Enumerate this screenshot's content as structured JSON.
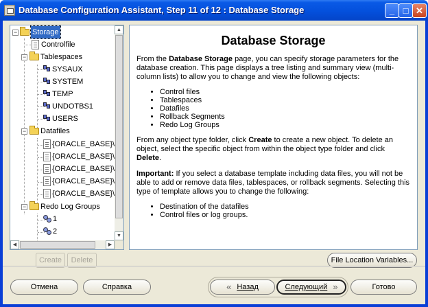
{
  "window": {
    "title": "Database Configuration Assistant, Step 11 of 12 : Database Storage",
    "controls": {
      "minimize": "_",
      "maximize": "□",
      "close": "✕"
    }
  },
  "tree": {
    "root": "Storage",
    "items": [
      {
        "label": "Controlfile"
      },
      {
        "label": "Tablespaces"
      },
      {
        "label": "SYSAUX"
      },
      {
        "label": "SYSTEM"
      },
      {
        "label": "TEMP"
      },
      {
        "label": "UNDOTBS1"
      },
      {
        "label": "USERS"
      },
      {
        "label": "Datafiles"
      },
      {
        "label": "{ORACLE_BASE}\\or"
      },
      {
        "label": "{ORACLE_BASE}\\or"
      },
      {
        "label": "{ORACLE_BASE}\\or"
      },
      {
        "label": "{ORACLE_BASE}\\or"
      },
      {
        "label": "{ORACLE_BASE}\\or"
      },
      {
        "label": "Redo Log Groups"
      },
      {
        "label": "1"
      },
      {
        "label": "2"
      }
    ],
    "icons": {
      "folder": "folder-icon",
      "file": "file-icon",
      "tablespace": "tablespace-icon",
      "log": "log-group-icon"
    }
  },
  "content": {
    "heading": "Database Storage",
    "p1_pre": "From the ",
    "p1_bold": "Database Storage",
    "p1_post": " page, you can specify storage parameters for the database creation. This page displays a tree listing and summary view (multi-column lists) to allow you to change and view the following objects:",
    "list1": [
      "Control files",
      "Tablespaces",
      "Datafiles",
      "Rollback Segments",
      "Redo Log Groups"
    ],
    "p2_a": "From any object type folder, click ",
    "p2_b": "Create",
    "p2_c": " to create a new object. To delete an object, select the specific object from within the object type folder and click ",
    "p2_d": "Delete",
    "p2_e": ".",
    "p3_bold": "Important:",
    "p3_text": " If you select a database template including data files, you will not be able to add or remove data files, tablespaces, or rollback segments. Selecting this type of template allows you to change the following:",
    "list2": [
      "Destination of the datafiles",
      "Control files or log groups."
    ]
  },
  "buttons": {
    "create": "Create",
    "delete": "Delete",
    "file_location_variables": "File Location Variables...",
    "cancel": "Отмена",
    "help": "Справка",
    "back": "Назад",
    "next": "Следующий",
    "finish": "Готово"
  }
}
